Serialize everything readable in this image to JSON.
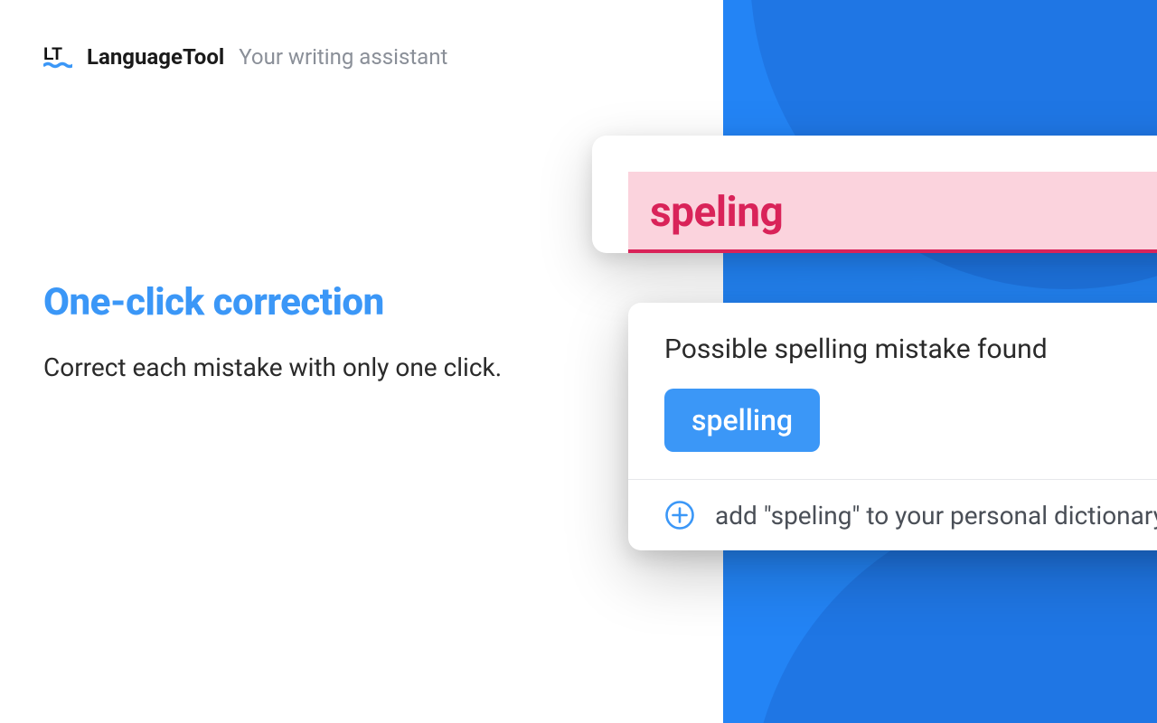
{
  "header": {
    "brand": "LanguageTool",
    "tagline": "Your writing assistant"
  },
  "hero": {
    "headline": "One-click correction",
    "description": "Correct each mistake with only one click."
  },
  "card": {
    "error_word": "speling"
  },
  "popup": {
    "message": "Possible spelling mistake found",
    "suggestion": "spelling",
    "add_dictionary_text": "add \"speling\" to your personal dictionary"
  },
  "colors": {
    "accent_blue": "#3b97f7",
    "error_red": "#d92359",
    "error_bg": "#fbd3dd",
    "bg_blue": "#2384f5"
  }
}
